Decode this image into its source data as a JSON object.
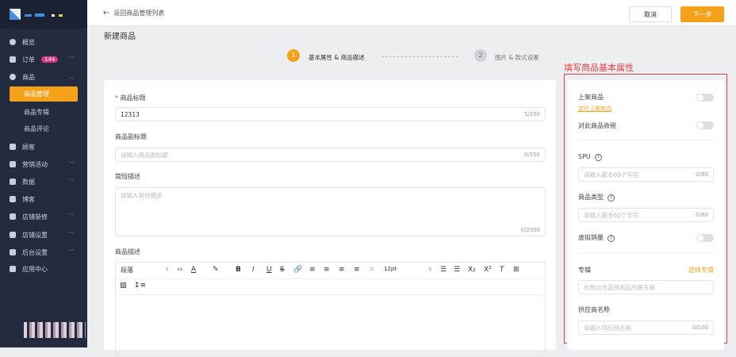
{
  "sidebar": {
    "items": [
      {
        "label": "概览",
        "icon": "dashboard-icon"
      },
      {
        "label": "订单",
        "icon": "order-icon",
        "badge": "144"
      },
      {
        "label": "商品",
        "icon": "goods-icon"
      },
      {
        "label": "商品管理"
      },
      {
        "label": "商品专辑"
      },
      {
        "label": "商品评论"
      },
      {
        "label": "顾客",
        "icon": "user-icon"
      },
      {
        "label": "营销活动",
        "icon": "tag-icon"
      },
      {
        "label": "数据",
        "icon": "chart-icon"
      },
      {
        "label": "博客",
        "icon": "blog-icon"
      },
      {
        "label": "店铺装修",
        "icon": "paint-icon"
      },
      {
        "label": "店铺设置",
        "icon": "store-icon"
      },
      {
        "label": "后台设置",
        "icon": "monitor-icon"
      },
      {
        "label": "应用中心",
        "icon": "wrench-icon"
      }
    ]
  },
  "header": {
    "back": "返回商品管理列表",
    "cancel": "取消",
    "next": "下一步"
  },
  "page": {
    "title": "新建商品"
  },
  "steps": [
    {
      "num": "1",
      "label": "基本属性 & 商品描述"
    },
    {
      "num": "2",
      "label": "图片 & 款式设置"
    }
  ],
  "form": {
    "title_label": "商品标题",
    "title_value": "12313",
    "title_count": "5/250",
    "subtitle_label": "商品副标题",
    "subtitle_ph": "请输入商品副标题",
    "subtitle_count": "0/250",
    "short_label": "简短描述",
    "short_ph": "请输入简短描述",
    "short_count": "0/2000",
    "desc_label": "商品描述",
    "para": "段落",
    "fontsize": "12pt"
  },
  "annotation": "填写商品基本属性",
  "side": {
    "publish": "上架商品",
    "schedule": "定时上架商品",
    "tax": "对此商品收税",
    "spu": "SPU",
    "spu_ph": "请输入最多60个字符",
    "spu_count": "0/60",
    "type": "商品类型",
    "type_ph": "请输入最多60个字符",
    "type_count": "0/60",
    "virtual": "虚拟销量",
    "album": "专辑",
    "album_select": "选择专辑",
    "album_ph": "右侧点击选择商品所属专辑",
    "supplier": "供应商名称",
    "supplier_ph": "请输入供应商名称",
    "supplier_count": "0/100"
  },
  "colors": {
    "accent": "#f5a21b",
    "sidebar": "#232c3e",
    "annotation": "#e8413c"
  }
}
